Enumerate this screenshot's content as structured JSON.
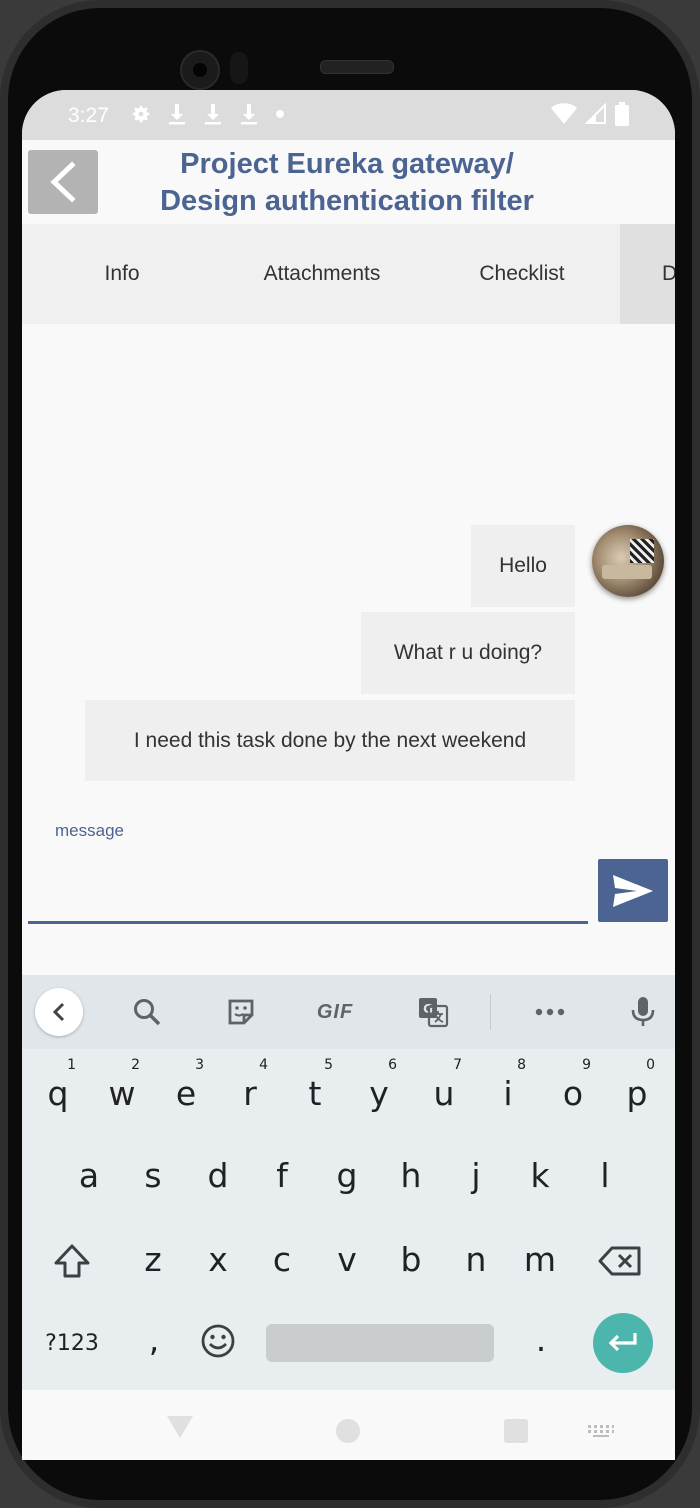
{
  "status_bar": {
    "time": "3:27"
  },
  "header": {
    "title_line1": "Project Eureka gateway/",
    "title_line2": "Design authentication filter"
  },
  "tabs": [
    {
      "label": "Info"
    },
    {
      "label": "Attachments"
    },
    {
      "label": "Checklist"
    },
    {
      "label": "D"
    }
  ],
  "messages": [
    {
      "text": "Hello"
    },
    {
      "text": "What r u doing?"
    },
    {
      "text": "I need this task done by the next weekend"
    }
  ],
  "composer": {
    "label": "message",
    "value": ""
  },
  "keyboard": {
    "toolbar": {
      "gif_label": "GIF"
    },
    "row1": [
      "q",
      "w",
      "e",
      "r",
      "t",
      "y",
      "u",
      "i",
      "o",
      "p"
    ],
    "row1_hints": [
      "1",
      "2",
      "3",
      "4",
      "5",
      "6",
      "7",
      "8",
      "9",
      "0"
    ],
    "row2": [
      "a",
      "s",
      "d",
      "f",
      "g",
      "h",
      "j",
      "k",
      "l"
    ],
    "row3": [
      "z",
      "x",
      "c",
      "v",
      "b",
      "n",
      "m"
    ],
    "symbols_label": "?123",
    "comma": ",",
    "period": "."
  },
  "colors": {
    "accent": "#4c6491",
    "enter": "#4db6ac",
    "bubble": "#efefef"
  }
}
